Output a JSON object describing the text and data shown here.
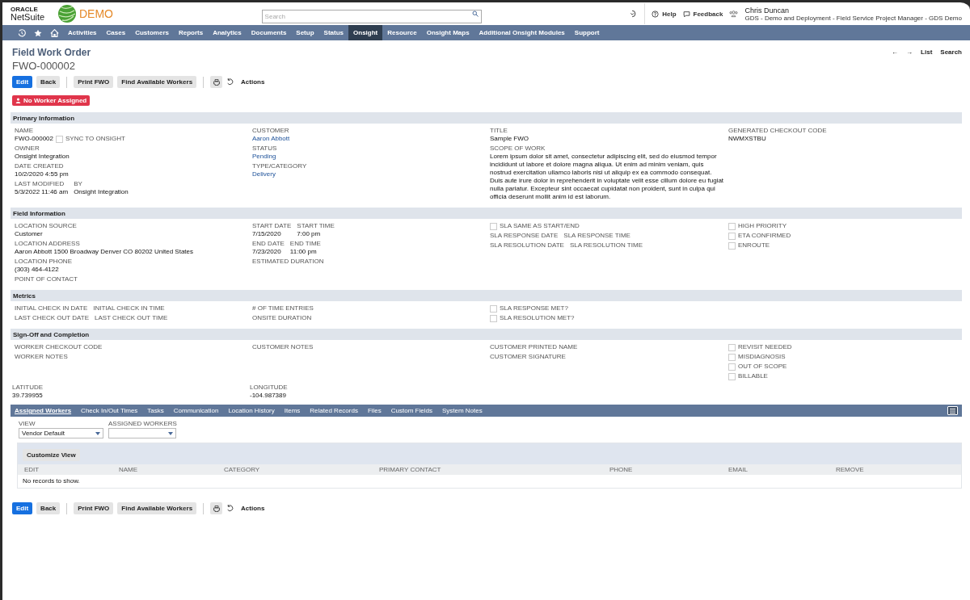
{
  "header": {
    "logo_small": "ORACLE",
    "logo": "NetSuite",
    "demo": "DEMO",
    "search": {
      "placeholder": "Search"
    },
    "help": "Help",
    "feedback": "Feedback",
    "user": {
      "name": "Chris Duncan",
      "role": "GDS - Demo and Deployment - Field Service Project Manager - GDS Demo"
    }
  },
  "nav": [
    {
      "label": "Activities",
      "selected": false
    },
    {
      "label": "Cases",
      "selected": false
    },
    {
      "label": "Customers",
      "selected": false
    },
    {
      "label": "Reports",
      "selected": false
    },
    {
      "label": "Analytics",
      "selected": false
    },
    {
      "label": "Documents",
      "selected": false
    },
    {
      "label": "Setup",
      "selected": false
    },
    {
      "label": "Status",
      "selected": false
    },
    {
      "label": "Onsight",
      "selected": true
    },
    {
      "label": "Resource",
      "selected": false
    },
    {
      "label": "Onsight Maps",
      "selected": false
    },
    {
      "label": "Additional Onsight Modules",
      "selected": false
    },
    {
      "label": "Support",
      "selected": false
    }
  ],
  "record": {
    "type": "Field Work Order",
    "id": "FWO-000002",
    "pager": [
      "←",
      "→",
      "List",
      "Search"
    ]
  },
  "toolbar": {
    "buttons": [
      {
        "label": "Edit",
        "primary": true
      },
      {
        "label": "Back",
        "primary": false
      },
      {
        "label": "Print FWO",
        "primary": false
      },
      {
        "label": "Find Available Workers",
        "primary": false
      }
    ],
    "actions": "Actions"
  },
  "badge": "No Worker Assigned",
  "sections": [
    {
      "title": "Primary Information",
      "columns": [
        [
          {
            "kind": "field",
            "label": "NAME",
            "value": "FWO-000002",
            "checkbox": {
              "label": "SYNC TO ONSIGHT",
              "checked": false
            }
          },
          {
            "kind": "field",
            "label": "OWNER",
            "value": "Onsight Integration"
          },
          {
            "kind": "field",
            "label": "DATE CREATED",
            "value": "10/2/2020 4:55 pm"
          },
          {
            "kind": "pair",
            "fields": [
              {
                "label": "LAST MODIFIED",
                "value": "5/3/2022 11:46 am"
              },
              {
                "label": "BY",
                "value": "Onsight Integration"
              }
            ]
          }
        ],
        [
          {
            "kind": "field",
            "label": "CUSTOMER",
            "value": "Aaron Abbott",
            "link": true
          },
          {
            "kind": "field",
            "label": "STATUS",
            "value": "Pending",
            "link": true
          },
          {
            "kind": "field",
            "label": "TYPE/CATEGORY",
            "value": "Delivery",
            "link": true
          }
        ],
        [
          {
            "kind": "field",
            "label": "TITLE",
            "value": "Sample FWO"
          },
          {
            "kind": "field",
            "label": "SCOPE OF WORK",
            "value": "Lorem ipsum dolor sit amet, consectetur adipiscing elit, sed do eiusmod tempor incididunt ut labore et dolore magna aliqua. Ut enim ad minim veniam, quis nostrud exercitation ullamco laboris nisi ut aliquip ex ea commodo consequat. Duis aute irure dolor in reprehenderit in voluptate velit esse cillum dolore eu fugiat nulla pariatur. Excepteur sint occaecat cupidatat non proident, sunt in culpa qui officia deserunt mollit anim id est laborum."
          }
        ],
        [
          {
            "kind": "field",
            "label": "GENERATED CHECKOUT CODE",
            "value": "NWMXSTBU"
          }
        ]
      ]
    },
    {
      "title": "Field Information",
      "columns": [
        [
          {
            "kind": "field",
            "label": "LOCATION SOURCE",
            "value": "Customer"
          },
          {
            "kind": "field",
            "label": "LOCATION ADDRESS",
            "value": "Aaron Abbott 1500 Broadway Denver CO 80202 United States"
          },
          {
            "kind": "field",
            "label": "LOCATION PHONE",
            "value": "(303) 464-4122"
          },
          {
            "kind": "field",
            "label": "POINT OF CONTACT"
          }
        ],
        [
          {
            "kind": "pair",
            "fields": [
              {
                "label": "START DATE",
                "value": "7/15/2020"
              },
              {
                "label": "START TIME",
                "value": "7:00 pm"
              }
            ]
          },
          {
            "kind": "pair",
            "fields": [
              {
                "label": "END DATE",
                "value": "7/23/2020"
              },
              {
                "label": "END TIME",
                "value": "11:00 pm"
              }
            ]
          },
          {
            "kind": "field",
            "label": "ESTIMATED DURATION"
          }
        ],
        [
          {
            "kind": "check",
            "label": "SLA SAME AS START/END",
            "checked": false
          },
          {
            "kind": "pair",
            "fields": [
              {
                "label": "SLA RESPONSE DATE"
              },
              {
                "label": "SLA RESPONSE TIME"
              }
            ]
          },
          {
            "kind": "pair",
            "fields": [
              {
                "label": "SLA RESOLUTION DATE"
              },
              {
                "label": "SLA RESOLUTION TIME"
              }
            ]
          }
        ],
        [
          {
            "kind": "check",
            "label": "HIGH PRIORITY",
            "checked": false
          },
          {
            "kind": "check",
            "label": "ETA CONFIRMED",
            "checked": false
          },
          {
            "kind": "check",
            "label": "ENROUTE",
            "checked": false
          }
        ]
      ]
    },
    {
      "title": "Metrics",
      "columns": [
        [
          {
            "kind": "pair",
            "fields": [
              {
                "label": "INITIAL CHECK IN DATE"
              },
              {
                "label": "INITIAL CHECK IN TIME"
              }
            ]
          },
          {
            "kind": "pair",
            "fields": [
              {
                "label": "LAST CHECK OUT DATE"
              },
              {
                "label": "LAST CHECK OUT TIME"
              }
            ]
          }
        ],
        [
          {
            "kind": "field",
            "label": "# OF TIME ENTRIES"
          },
          {
            "kind": "field",
            "label": "ONSITE DURATION"
          }
        ],
        [
          {
            "kind": "check",
            "label": "SLA RESPONSE MET?",
            "checked": false
          },
          {
            "kind": "check",
            "label": "SLA RESOLUTION MET?",
            "checked": false
          }
        ],
        []
      ]
    },
    {
      "title": "Sign-Off and Completion",
      "columns": [
        [
          {
            "kind": "field",
            "label": "WORKER CHECKOUT CODE"
          },
          {
            "kind": "field",
            "label": "WORKER NOTES"
          }
        ],
        [
          {
            "kind": "field",
            "label": "CUSTOMER NOTES"
          }
        ],
        [
          {
            "kind": "field",
            "label": "CUSTOMER PRINTED NAME"
          },
          {
            "kind": "field",
            "label": "CUSTOMER SIGNATURE"
          }
        ],
        [
          {
            "kind": "check",
            "label": "REVISIT NEEDED",
            "checked": false
          },
          {
            "kind": "check",
            "label": "MISDIAGNOSIS",
            "checked": false
          },
          {
            "kind": "check",
            "label": "OUT OF SCOPE",
            "checked": false
          },
          {
            "kind": "check",
            "label": "BILLABLE",
            "checked": false
          }
        ]
      ]
    }
  ],
  "coordinates": [
    {
      "label": "LATITUDE",
      "value": "39.739955"
    },
    {
      "label": "LONGITUDE",
      "value": "-104.987389"
    }
  ],
  "subtabs": [
    {
      "label": "Assigned Workers",
      "selected": true
    },
    {
      "label": "Check In/Out Times",
      "selected": false
    },
    {
      "label": "Tasks",
      "selected": false
    },
    {
      "label": "Communication",
      "selected": false
    },
    {
      "label": "Location History",
      "selected": false
    },
    {
      "label": "Items",
      "selected": false
    },
    {
      "label": "Related Records",
      "selected": false
    },
    {
      "label": "Files",
      "selected": false
    },
    {
      "label": "Custom Fields",
      "selected": false
    },
    {
      "label": "System Notes",
      "selected": false
    }
  ],
  "filters": [
    {
      "label": "VIEW",
      "value": "Vendor Default"
    },
    {
      "label": "ASSIGNED WORKERS"
    }
  ],
  "customize": "Customize View",
  "table": {
    "columns": [
      "EDIT",
      "NAME",
      "CATEGORY",
      "PRIMARY CONTACT",
      "PHONE",
      "EMAIL",
      "REMOVE"
    ],
    "empty": "No records to show."
  },
  "bottom_toolbar": {
    "buttons": [
      {
        "label": "Edit",
        "primary": true
      },
      {
        "label": "Back",
        "primary": false
      },
      {
        "label": "Print FWO",
        "primary": false
      },
      {
        "label": "Find Available Workers",
        "primary": false
      }
    ],
    "actions": "Actions"
  }
}
